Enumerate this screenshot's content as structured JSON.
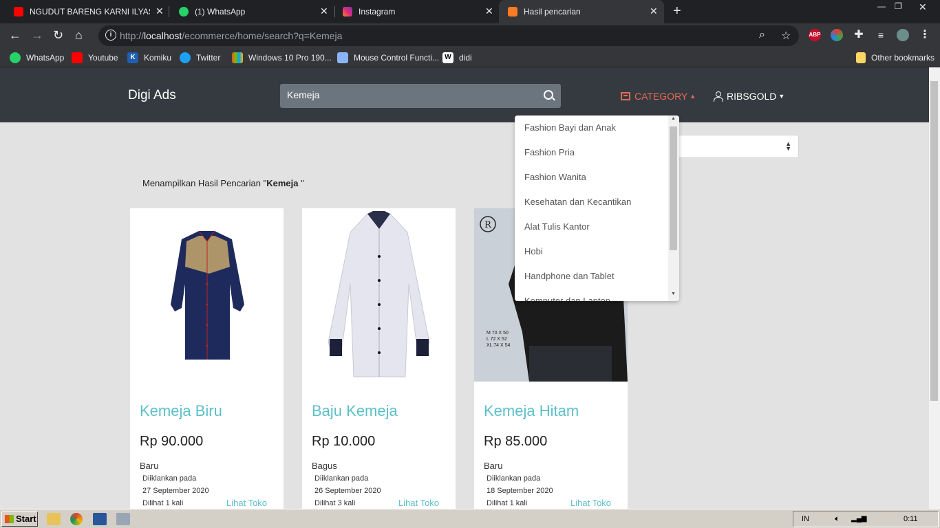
{
  "browser": {
    "tabs": [
      {
        "title": "NGUDUT BARENG KARNI ILYAS☐ (",
        "icon": "youtube-icon"
      },
      {
        "title": "(1) WhatsApp",
        "icon": "whatsapp-icon"
      },
      {
        "title": "Instagram",
        "icon": "instagram-icon"
      },
      {
        "title": "Hasil pencarian",
        "icon": "xampp-icon"
      }
    ],
    "url_prefix": "http://",
    "url_host": "localhost",
    "url_path": "/ecommerce/home/search?q=Kemeja",
    "extensions": [
      "ABP"
    ],
    "bookmarks": [
      "WhatsApp",
      "Youtube",
      "Komiku",
      "Twitter",
      "Windows 10 Pro 190...",
      "Mouse Control Functi...",
      "didi"
    ],
    "other_bookmarks": "Other bookmarks"
  },
  "site": {
    "brand": "Digi Ads",
    "search_value": "Kemeja",
    "category_label": "CATEGORY",
    "user_label": "RIBSGOLD",
    "result_prefix": "Menampilkan Hasil Pencarian \"",
    "result_query": "Kemeja",
    "result_suffix": " \"",
    "categories": [
      "Fashion Bayi dan Anak",
      "Fashion Pria",
      "Fashion Wanita",
      "Kesehatan dan Kecantikan",
      "Alat Tulis Kantor",
      "Hobi",
      "Handphone dan Tablet",
      "Komputer dan Laptop"
    ],
    "products": [
      {
        "name": "Kemeja Biru",
        "price": "Rp 90.000",
        "condition": "Baru",
        "advertised_label": "Diiklankan pada",
        "date": "27 September 2020",
        "views": "Dilihat 1 kali",
        "shop_link": "Lihat Toko"
      },
      {
        "name": "Baju Kemeja",
        "price": "Rp 10.000",
        "condition": "Bagus",
        "advertised_label": "Diiklankan pada",
        "date": "26 September 2020",
        "views": "Dilihat 3 kali",
        "shop_link": "Lihat Toko"
      },
      {
        "name": "Kemeja Hitam",
        "price": "Rp 85.000",
        "condition": "Baru",
        "advertised_label": "Diiklankan pada",
        "date": "18 September 2020",
        "views": "Dilihat 1 kali",
        "shop_link": "Lihat Toko"
      }
    ],
    "size_chart": [
      "M 70 X 50",
      "L 72 X 52",
      "XL 74 X 54"
    ]
  },
  "taskbar": {
    "start_label": "Start",
    "language": "IN",
    "clock": "0:11"
  },
  "colors": {
    "navbar": "#343a40",
    "accent_teal": "#5bc0c8",
    "category_orange": "#e96b56"
  }
}
